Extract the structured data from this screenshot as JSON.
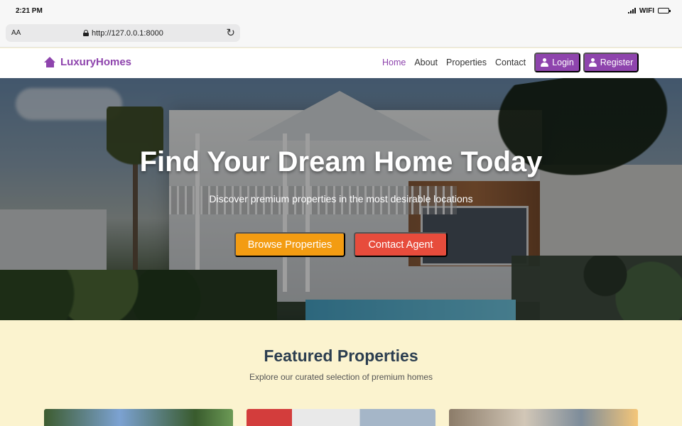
{
  "status_bar": {
    "time": "2:21 PM",
    "wifi": "WIFI"
  },
  "browser": {
    "aa": "AA",
    "url": "http://127.0.0.1:8000",
    "icons": [
      "lock-icon",
      "reload-icon"
    ]
  },
  "navbar": {
    "brand": "LuxuryHomes",
    "links": [
      "Home",
      "About",
      "Properties",
      "Contact"
    ],
    "login": "Login",
    "register": "Register",
    "brand_color": "#8e44ad"
  },
  "hero": {
    "title": "Find Your Dream Home Today",
    "subtitle": "Discover premium properties in the most desirable locations",
    "browse_button": "Browse Properties",
    "contact_button": "Contact Agent",
    "colors": {
      "browse": "#f39c12",
      "contact": "#e74c3c"
    }
  },
  "featured": {
    "title": "Featured Properties",
    "subtitle": "Explore our curated selection of premium homes",
    "background": "#fbf3cf"
  }
}
